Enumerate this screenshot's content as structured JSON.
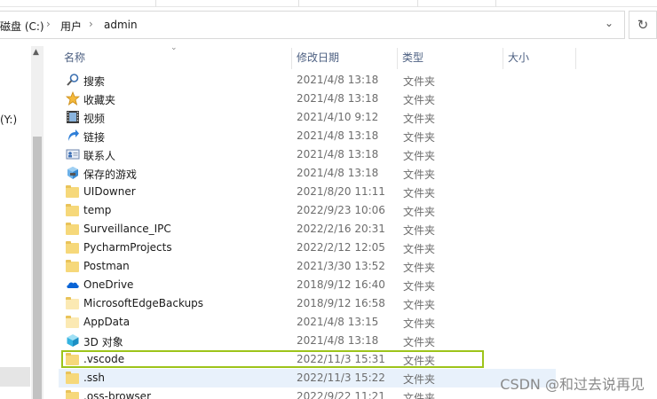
{
  "address": {
    "crumbs": [
      "磁盘 (C:)",
      "用户",
      "admin"
    ]
  },
  "nav": {
    "drive_fragment": "(Y:)"
  },
  "columns": {
    "name": "名称",
    "date": "修改日期",
    "type": "类型",
    "size": "大小"
  },
  "rows": [
    {
      "name": "搜索",
      "date": "2021/4/8 13:18",
      "type": "文件夹",
      "icon": "search-icon"
    },
    {
      "name": "收藏夹",
      "date": "2021/4/8 13:18",
      "type": "文件夹",
      "icon": "star-icon"
    },
    {
      "name": "视频",
      "date": "2021/4/10 9:12",
      "type": "文件夹",
      "icon": "video-icon"
    },
    {
      "name": "链接",
      "date": "2021/4/8 13:18",
      "type": "文件夹",
      "icon": "link-icon"
    },
    {
      "name": "联系人",
      "date": "2021/4/8 13:18",
      "type": "文件夹",
      "icon": "contact-icon"
    },
    {
      "name": "保存的游戏",
      "date": "2021/4/8 13:18",
      "type": "文件夹",
      "icon": "game-icon"
    },
    {
      "name": "UIDowner",
      "date": "2021/8/20 11:11",
      "type": "文件夹",
      "icon": "folder-icon"
    },
    {
      "name": "temp",
      "date": "2022/9/23 10:06",
      "type": "文件夹",
      "icon": "folder-icon"
    },
    {
      "name": "Surveillance_IPC",
      "date": "2022/2/16 20:31",
      "type": "文件夹",
      "icon": "folder-icon"
    },
    {
      "name": "PycharmProjects",
      "date": "2022/2/12 12:05",
      "type": "文件夹",
      "icon": "folder-icon"
    },
    {
      "name": "Postman",
      "date": "2021/3/30 13:52",
      "type": "文件夹",
      "icon": "folder-icon"
    },
    {
      "name": "OneDrive",
      "date": "2018/9/12 16:40",
      "type": "文件夹",
      "icon": "cloud-icon"
    },
    {
      "name": "MicrosoftEdgeBackups",
      "date": "2018/9/12 16:58",
      "type": "文件夹",
      "icon": "folder-pale-icon"
    },
    {
      "name": "AppData",
      "date": "2021/4/8 13:15",
      "type": "文件夹",
      "icon": "folder-pale-icon"
    },
    {
      "name": "3D 对象",
      "date": "2021/4/8 13:18",
      "type": "文件夹",
      "icon": "cube-icon"
    },
    {
      "name": ".vscode",
      "date": "2022/11/3 15:31",
      "type": "文件夹",
      "icon": "folder-icon"
    },
    {
      "name": ".ssh",
      "date": "2022/11/3 15:22",
      "type": "文件夹",
      "icon": "folder-icon"
    },
    {
      "name": ".oss-browser",
      "date": "2022/9/22 11:21",
      "type": "文件夹",
      "icon": "folder-icon"
    }
  ],
  "watermark": "CSDN @和过去说再见"
}
